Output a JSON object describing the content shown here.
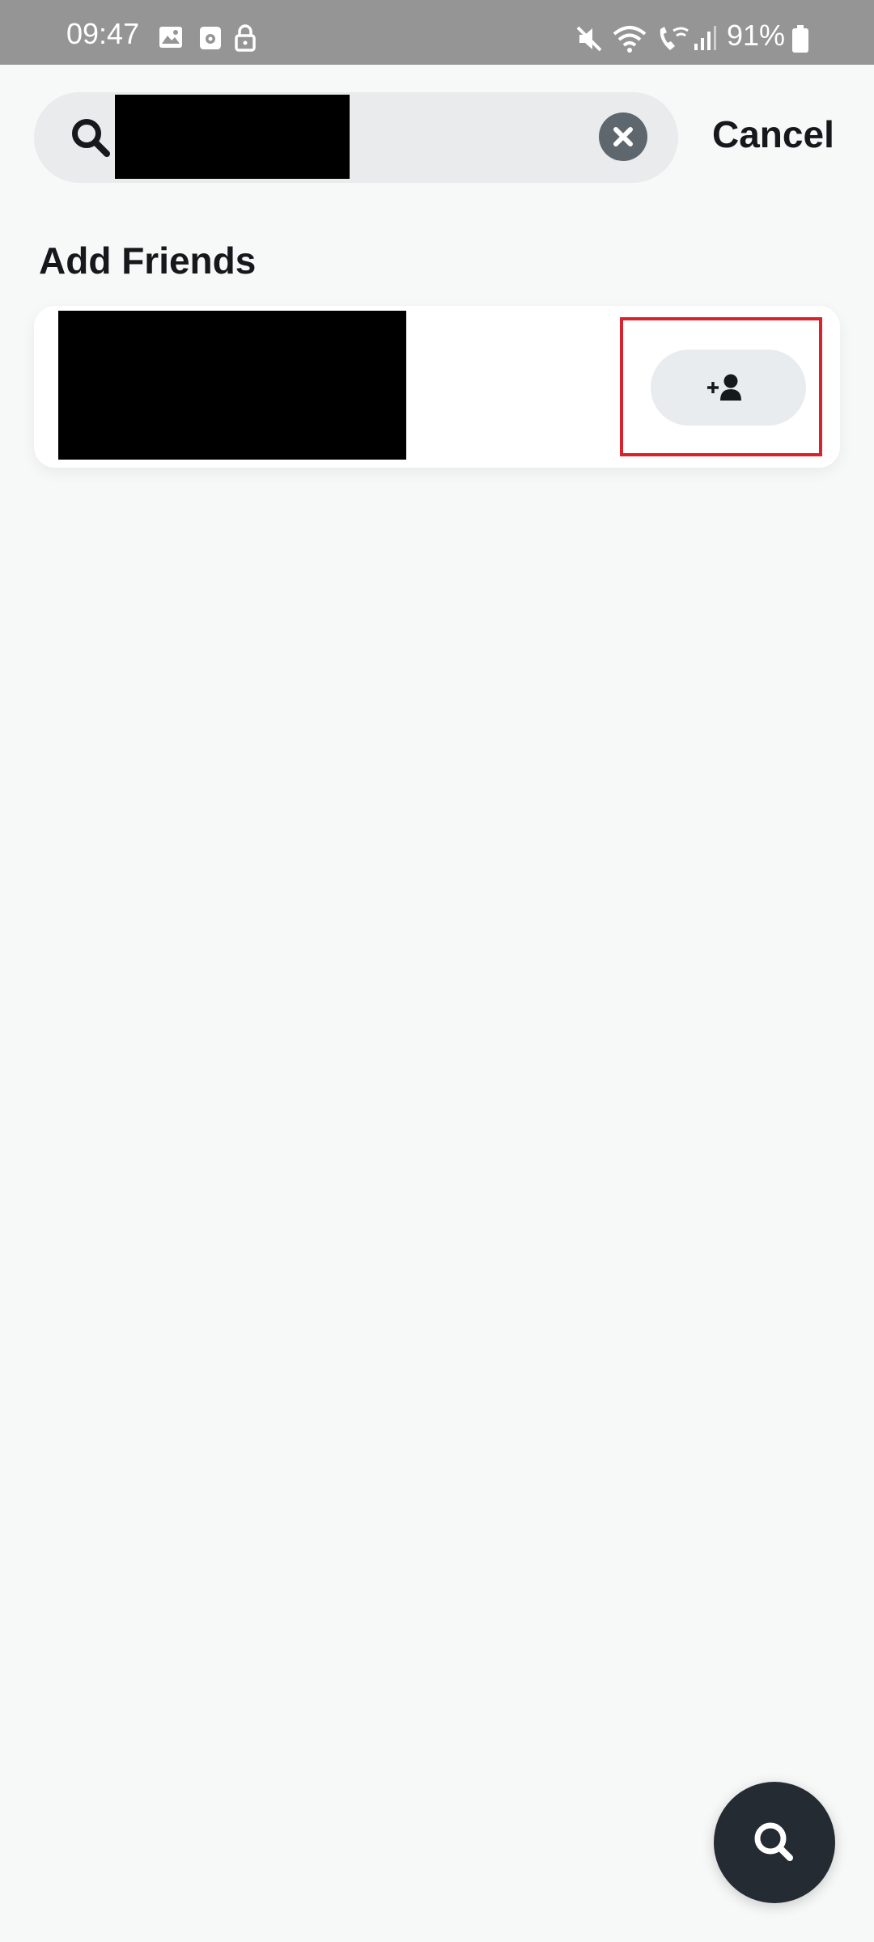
{
  "status_bar": {
    "time": "09:47",
    "battery": "91%",
    "icons": [
      "gallery-icon",
      "sd-card-icon",
      "lock-icon",
      "mute-icon",
      "wifi-icon",
      "wifi-call-icon",
      "signal-icon",
      "battery-icon"
    ]
  },
  "search": {
    "query": "",
    "clear_icon": "close-icon",
    "cancel_label": "Cancel"
  },
  "section": {
    "title": "Add Friends"
  },
  "results": [
    {
      "name": "",
      "action_icon": "add-friend-icon"
    }
  ],
  "fab": {
    "icon": "search-icon"
  },
  "colors": {
    "background": "#f7f8f8",
    "status_bar": "#959595",
    "search_bg": "#e9ebec",
    "text_primary": "#16191c",
    "highlight": "#d8232f",
    "fab": "#252b33"
  }
}
